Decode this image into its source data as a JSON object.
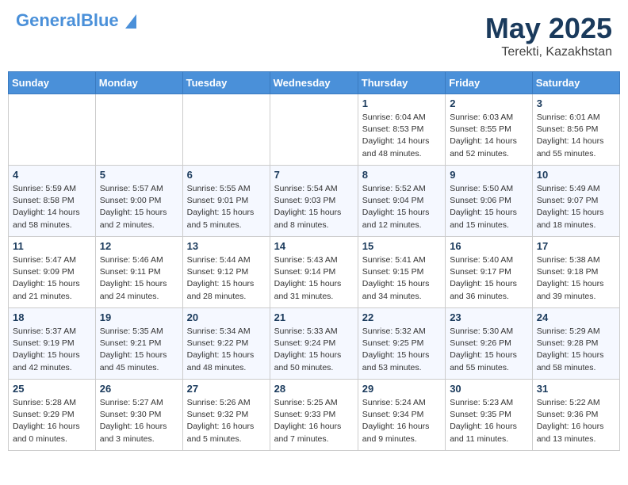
{
  "header": {
    "logo_general": "General",
    "logo_blue": "Blue",
    "logo_tagline": "",
    "main_title": "May 2025",
    "subtitle": "Terekti, Kazakhstan"
  },
  "days_of_week": [
    "Sunday",
    "Monday",
    "Tuesday",
    "Wednesday",
    "Thursday",
    "Friday",
    "Saturday"
  ],
  "weeks": [
    {
      "days": [
        {
          "number": "",
          "sunrise": "",
          "sunset": "",
          "daylight": "",
          "empty": true
        },
        {
          "number": "",
          "sunrise": "",
          "sunset": "",
          "daylight": "",
          "empty": true
        },
        {
          "number": "",
          "sunrise": "",
          "sunset": "",
          "daylight": "",
          "empty": true
        },
        {
          "number": "",
          "sunrise": "",
          "sunset": "",
          "daylight": "",
          "empty": true
        },
        {
          "number": "1",
          "sunrise": "Sunrise: 6:04 AM",
          "sunset": "Sunset: 8:53 PM",
          "daylight": "Daylight: 14 hours and 48 minutes.",
          "empty": false
        },
        {
          "number": "2",
          "sunrise": "Sunrise: 6:03 AM",
          "sunset": "Sunset: 8:55 PM",
          "daylight": "Daylight: 14 hours and 52 minutes.",
          "empty": false
        },
        {
          "number": "3",
          "sunrise": "Sunrise: 6:01 AM",
          "sunset": "Sunset: 8:56 PM",
          "daylight": "Daylight: 14 hours and 55 minutes.",
          "empty": false
        }
      ]
    },
    {
      "days": [
        {
          "number": "4",
          "sunrise": "Sunrise: 5:59 AM",
          "sunset": "Sunset: 8:58 PM",
          "daylight": "Daylight: 14 hours and 58 minutes.",
          "empty": false
        },
        {
          "number": "5",
          "sunrise": "Sunrise: 5:57 AM",
          "sunset": "Sunset: 9:00 PM",
          "daylight": "Daylight: 15 hours and 2 minutes.",
          "empty": false
        },
        {
          "number": "6",
          "sunrise": "Sunrise: 5:55 AM",
          "sunset": "Sunset: 9:01 PM",
          "daylight": "Daylight: 15 hours and 5 minutes.",
          "empty": false
        },
        {
          "number": "7",
          "sunrise": "Sunrise: 5:54 AM",
          "sunset": "Sunset: 9:03 PM",
          "daylight": "Daylight: 15 hours and 8 minutes.",
          "empty": false
        },
        {
          "number": "8",
          "sunrise": "Sunrise: 5:52 AM",
          "sunset": "Sunset: 9:04 PM",
          "daylight": "Daylight: 15 hours and 12 minutes.",
          "empty": false
        },
        {
          "number": "9",
          "sunrise": "Sunrise: 5:50 AM",
          "sunset": "Sunset: 9:06 PM",
          "daylight": "Daylight: 15 hours and 15 minutes.",
          "empty": false
        },
        {
          "number": "10",
          "sunrise": "Sunrise: 5:49 AM",
          "sunset": "Sunset: 9:07 PM",
          "daylight": "Daylight: 15 hours and 18 minutes.",
          "empty": false
        }
      ]
    },
    {
      "days": [
        {
          "number": "11",
          "sunrise": "Sunrise: 5:47 AM",
          "sunset": "Sunset: 9:09 PM",
          "daylight": "Daylight: 15 hours and 21 minutes.",
          "empty": false
        },
        {
          "number": "12",
          "sunrise": "Sunrise: 5:46 AM",
          "sunset": "Sunset: 9:11 PM",
          "daylight": "Daylight: 15 hours and 24 minutes.",
          "empty": false
        },
        {
          "number": "13",
          "sunrise": "Sunrise: 5:44 AM",
          "sunset": "Sunset: 9:12 PM",
          "daylight": "Daylight: 15 hours and 28 minutes.",
          "empty": false
        },
        {
          "number": "14",
          "sunrise": "Sunrise: 5:43 AM",
          "sunset": "Sunset: 9:14 PM",
          "daylight": "Daylight: 15 hours and 31 minutes.",
          "empty": false
        },
        {
          "number": "15",
          "sunrise": "Sunrise: 5:41 AM",
          "sunset": "Sunset: 9:15 PM",
          "daylight": "Daylight: 15 hours and 34 minutes.",
          "empty": false
        },
        {
          "number": "16",
          "sunrise": "Sunrise: 5:40 AM",
          "sunset": "Sunset: 9:17 PM",
          "daylight": "Daylight: 15 hours and 36 minutes.",
          "empty": false
        },
        {
          "number": "17",
          "sunrise": "Sunrise: 5:38 AM",
          "sunset": "Sunset: 9:18 PM",
          "daylight": "Daylight: 15 hours and 39 minutes.",
          "empty": false
        }
      ]
    },
    {
      "days": [
        {
          "number": "18",
          "sunrise": "Sunrise: 5:37 AM",
          "sunset": "Sunset: 9:19 PM",
          "daylight": "Daylight: 15 hours and 42 minutes.",
          "empty": false
        },
        {
          "number": "19",
          "sunrise": "Sunrise: 5:35 AM",
          "sunset": "Sunset: 9:21 PM",
          "daylight": "Daylight: 15 hours and 45 minutes.",
          "empty": false
        },
        {
          "number": "20",
          "sunrise": "Sunrise: 5:34 AM",
          "sunset": "Sunset: 9:22 PM",
          "daylight": "Daylight: 15 hours and 48 minutes.",
          "empty": false
        },
        {
          "number": "21",
          "sunrise": "Sunrise: 5:33 AM",
          "sunset": "Sunset: 9:24 PM",
          "daylight": "Daylight: 15 hours and 50 minutes.",
          "empty": false
        },
        {
          "number": "22",
          "sunrise": "Sunrise: 5:32 AM",
          "sunset": "Sunset: 9:25 PM",
          "daylight": "Daylight: 15 hours and 53 minutes.",
          "empty": false
        },
        {
          "number": "23",
          "sunrise": "Sunrise: 5:30 AM",
          "sunset": "Sunset: 9:26 PM",
          "daylight": "Daylight: 15 hours and 55 minutes.",
          "empty": false
        },
        {
          "number": "24",
          "sunrise": "Sunrise: 5:29 AM",
          "sunset": "Sunset: 9:28 PM",
          "daylight": "Daylight: 15 hours and 58 minutes.",
          "empty": false
        }
      ]
    },
    {
      "days": [
        {
          "number": "25",
          "sunrise": "Sunrise: 5:28 AM",
          "sunset": "Sunset: 9:29 PM",
          "daylight": "Daylight: 16 hours and 0 minutes.",
          "empty": false
        },
        {
          "number": "26",
          "sunrise": "Sunrise: 5:27 AM",
          "sunset": "Sunset: 9:30 PM",
          "daylight": "Daylight: 16 hours and 3 minutes.",
          "empty": false
        },
        {
          "number": "27",
          "sunrise": "Sunrise: 5:26 AM",
          "sunset": "Sunset: 9:32 PM",
          "daylight": "Daylight: 16 hours and 5 minutes.",
          "empty": false
        },
        {
          "number": "28",
          "sunrise": "Sunrise: 5:25 AM",
          "sunset": "Sunset: 9:33 PM",
          "daylight": "Daylight: 16 hours and 7 minutes.",
          "empty": false
        },
        {
          "number": "29",
          "sunrise": "Sunrise: 5:24 AM",
          "sunset": "Sunset: 9:34 PM",
          "daylight": "Daylight: 16 hours and 9 minutes.",
          "empty": false
        },
        {
          "number": "30",
          "sunrise": "Sunrise: 5:23 AM",
          "sunset": "Sunset: 9:35 PM",
          "daylight": "Daylight: 16 hours and 11 minutes.",
          "empty": false
        },
        {
          "number": "31",
          "sunrise": "Sunrise: 5:22 AM",
          "sunset": "Sunset: 9:36 PM",
          "daylight": "Daylight: 16 hours and 13 minutes.",
          "empty": false
        }
      ]
    }
  ]
}
